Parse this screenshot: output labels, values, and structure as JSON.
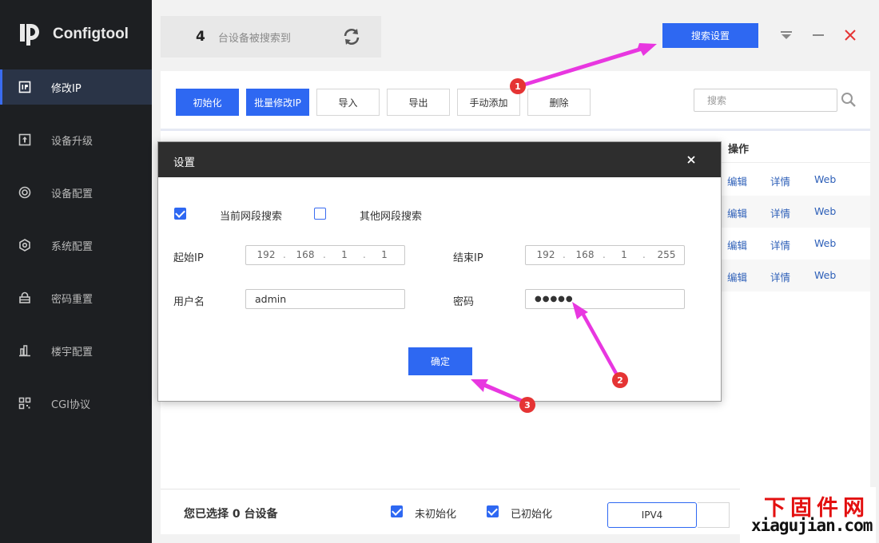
{
  "app": {
    "title": "Configtool"
  },
  "sidebar": {
    "items": [
      {
        "label": "修改IP",
        "icon": "ip-icon",
        "active": true
      },
      {
        "label": "设备升级",
        "icon": "upgrade-icon",
        "active": false
      },
      {
        "label": "设备配置",
        "icon": "device-config-icon",
        "active": false
      },
      {
        "label": "系统配置",
        "icon": "system-config-icon",
        "active": false
      },
      {
        "label": "密码重置",
        "icon": "password-reset-icon",
        "active": false
      },
      {
        "label": "楼宇配置",
        "icon": "building-config-icon",
        "active": false
      },
      {
        "label": "CGI协议",
        "icon": "cgi-icon",
        "active": false
      }
    ]
  },
  "header": {
    "device_count": "4",
    "device_count_label": "台设备被搜索到",
    "search_settings_label": "搜索设置"
  },
  "toolbar": {
    "init_label": "初始化",
    "batch_ip_label": "批量修改IP",
    "import_label": "导入",
    "export_label": "导出",
    "manual_add_label": "手动添加",
    "delete_label": "删除",
    "search_placeholder": "搜索"
  },
  "table": {
    "op_header": "操作",
    "rows": [
      {
        "edit": "编辑",
        "detail": "详情",
        "web": "Web"
      },
      {
        "edit": "编辑",
        "detail": "详情",
        "web": "Web"
      },
      {
        "edit": "编辑",
        "detail": "详情",
        "web": "Web"
      },
      {
        "edit": "编辑",
        "detail": "详情",
        "web": "Web"
      }
    ]
  },
  "bottom": {
    "selected_prefix": "您已选择",
    "selected_count": "0",
    "selected_suffix": "台设备",
    "uninit_label": "未初始化",
    "init_label": "已初始化",
    "ipv4_label": "IPV4"
  },
  "modal": {
    "title": "设置",
    "current_segment_label": "当前网段搜索",
    "current_segment_checked": true,
    "other_segment_label": "其他网段搜索",
    "other_segment_checked": false,
    "start_ip_label": "起始IP",
    "start_ip": [
      "192",
      "168",
      "1",
      "1"
    ],
    "end_ip_label": "结束IP",
    "end_ip": [
      "192",
      "168",
      "1",
      "255"
    ],
    "username_label": "用户名",
    "username_value": "admin",
    "password_label": "密码",
    "password_value": "●●●●●",
    "ok_label": "确定"
  },
  "annotations": {
    "badge1": "1",
    "badge2": "2",
    "badge3": "3",
    "arrow_color": "#e837e0"
  },
  "watermark": {
    "cn": "下固件网",
    "en": "xiagujian.com"
  },
  "colors": {
    "accent": "#2e68f2",
    "sidebar_bg": "#1d1f22",
    "badge": "#e53434",
    "link": "#2d5fb8"
  }
}
